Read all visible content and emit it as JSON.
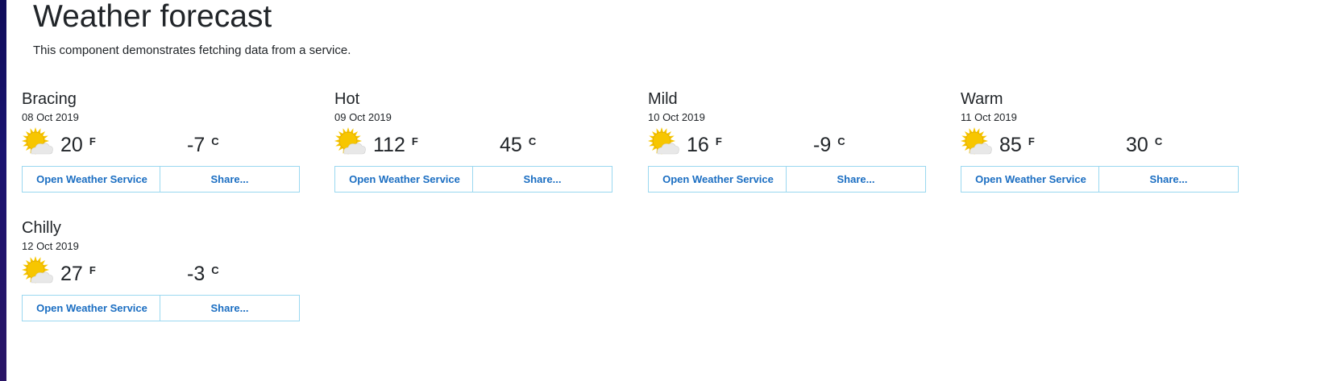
{
  "page": {
    "title": "Weather forecast",
    "description": "This component demonstrates fetching data from a service."
  },
  "forecasts": [
    {
      "summary": "Bracing",
      "date": "08 Oct 2019",
      "temp_f": "20",
      "unit_f": "F",
      "temp_c": "-7",
      "unit_c": "C",
      "icon": "sun-cloud-icon",
      "open_label": "Open Weather Service",
      "share_label": "Share..."
    },
    {
      "summary": "Hot",
      "date": "09 Oct 2019",
      "temp_f": "112",
      "unit_f": "F",
      "temp_c": "45",
      "unit_c": "C",
      "icon": "sun-cloud-icon",
      "open_label": "Open Weather Service",
      "share_label": "Share..."
    },
    {
      "summary": "Mild",
      "date": "10 Oct 2019",
      "temp_f": "16",
      "unit_f": "F",
      "temp_c": "-9",
      "unit_c": "C",
      "icon": "sun-cloud-icon",
      "open_label": "Open Weather Service",
      "share_label": "Share..."
    },
    {
      "summary": "Warm",
      "date": "11 Oct 2019",
      "temp_f": "85",
      "unit_f": "F",
      "temp_c": "30",
      "unit_c": "C",
      "icon": "sun-cloud-icon",
      "open_label": "Open Weather Service",
      "share_label": "Share..."
    },
    {
      "summary": "Chilly",
      "date": "12 Oct 2019",
      "temp_f": "27",
      "unit_f": "F",
      "temp_c": "-3",
      "unit_c": "C",
      "icon": "sun-cloud-icon",
      "open_label": "Open Weather Service",
      "share_label": "Share..."
    }
  ],
  "colors": {
    "sun": "#f7c600",
    "sun_outline": "#e0a800",
    "cloud": "#e8e8e8",
    "button_text": "#1b6ec2",
    "button_border": "#9ad8f0"
  }
}
